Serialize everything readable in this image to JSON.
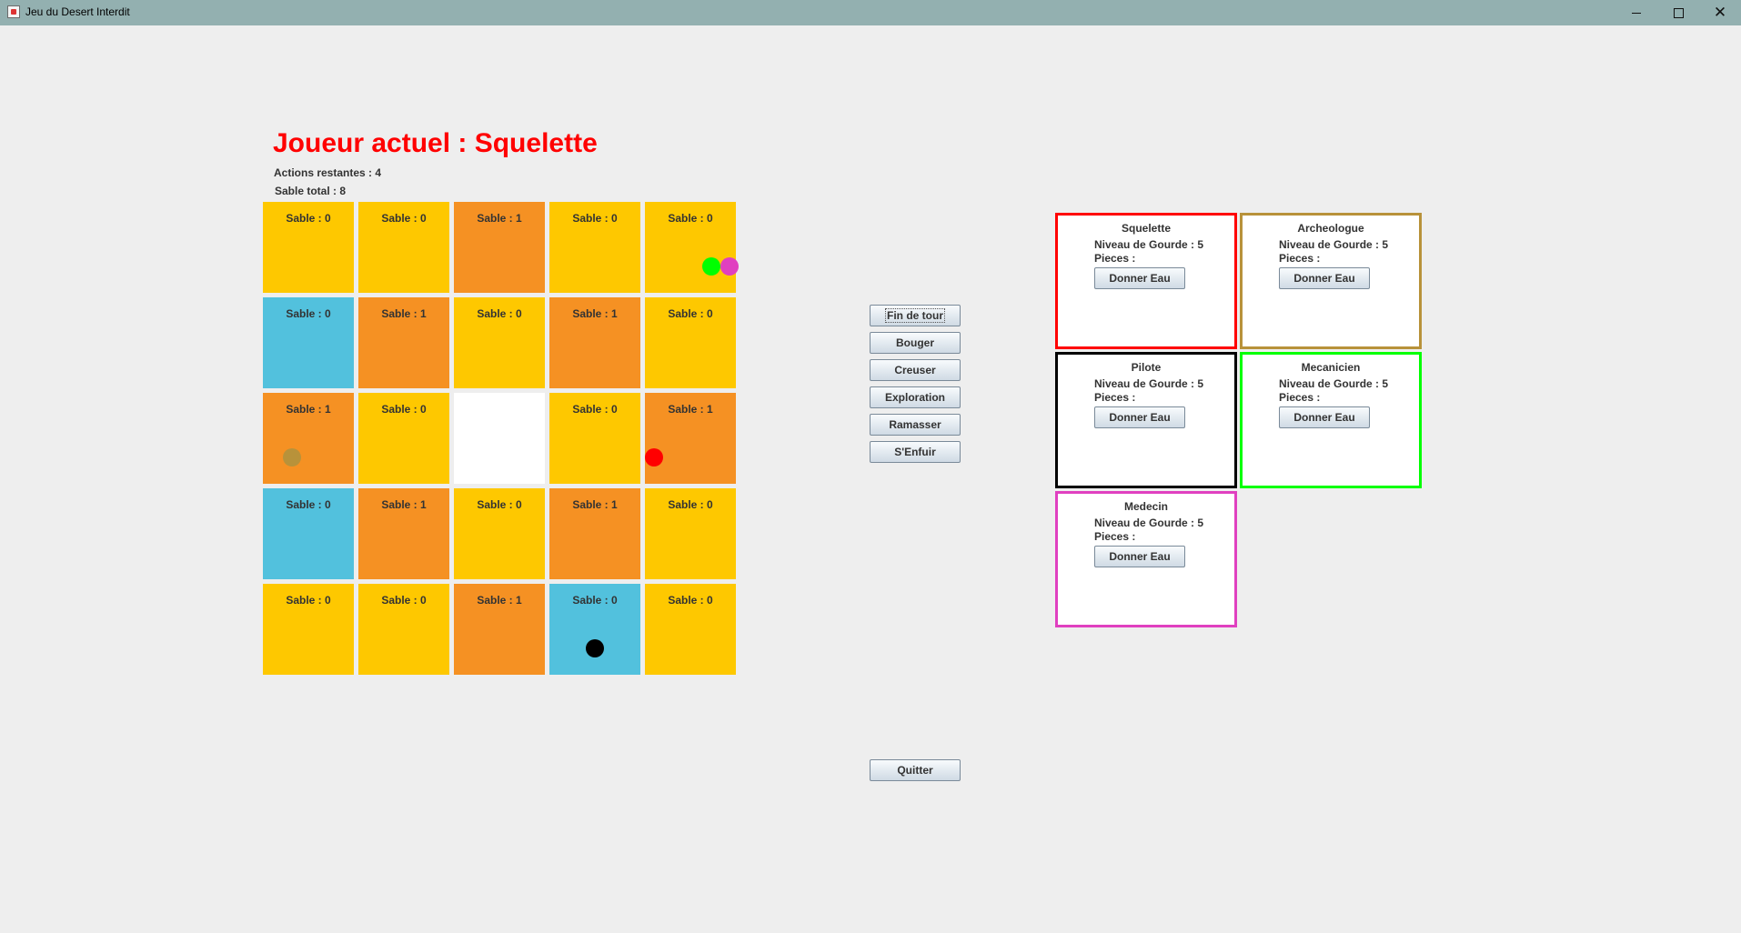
{
  "window": {
    "title": "Jeu du Desert Interdit",
    "minimize_icon": "minimize-icon",
    "maximize_icon": "maximize-icon",
    "close_icon": "close-icon"
  },
  "header": {
    "current_player": "Joueur actuel : Squelette",
    "actions_remaining": "Actions restantes : 4",
    "sand_total": "Sable total : 8"
  },
  "colors": {
    "desert": "#fec800",
    "sanded": "#f59123",
    "water": "#52c1dd",
    "empty": "#ffffff",
    "title_red": "#ff0000"
  },
  "grid": {
    "rows": [
      [
        {
          "label": "Sable : 0",
          "type": "desert"
        },
        {
          "label": "Sable : 0",
          "type": "desert"
        },
        {
          "label": "Sable : 1",
          "type": "sanded"
        },
        {
          "label": "Sable : 0",
          "type": "desert"
        },
        {
          "label": "Sable : 0",
          "type": "desert",
          "pawns": [
            "Mecanicien",
            "Medecin"
          ]
        }
      ],
      [
        {
          "label": "Sable : 0",
          "type": "water"
        },
        {
          "label": "Sable : 1",
          "type": "sanded"
        },
        {
          "label": "Sable : 0",
          "type": "desert"
        },
        {
          "label": "Sable : 1",
          "type": "sanded"
        },
        {
          "label": "Sable : 0",
          "type": "desert"
        }
      ],
      [
        {
          "label": "Sable : 1",
          "type": "sanded",
          "pawns": [
            "Archeologue"
          ]
        },
        {
          "label": "Sable : 0",
          "type": "desert"
        },
        {
          "label": "",
          "type": "empty"
        },
        {
          "label": "Sable : 0",
          "type": "desert"
        },
        {
          "label": "Sable : 1",
          "type": "sanded",
          "pawns": [
            "Squelette"
          ]
        }
      ],
      [
        {
          "label": "Sable : 0",
          "type": "water"
        },
        {
          "label": "Sable : 1",
          "type": "sanded"
        },
        {
          "label": "Sable : 0",
          "type": "desert"
        },
        {
          "label": "Sable : 1",
          "type": "sanded"
        },
        {
          "label": "Sable : 0",
          "type": "desert"
        }
      ],
      [
        {
          "label": "Sable : 0",
          "type": "desert"
        },
        {
          "label": "Sable : 0",
          "type": "desert"
        },
        {
          "label": "Sable : 1",
          "type": "sanded"
        },
        {
          "label": "Sable : 0",
          "type": "water",
          "pawns": [
            "Pilote"
          ]
        },
        {
          "label": "Sable : 0",
          "type": "desert"
        }
      ]
    ]
  },
  "actions": {
    "end_turn": "Fin de tour",
    "move": "Bouger",
    "dig": "Creuser",
    "explore": "Exploration",
    "pick_up": "Ramasser",
    "escape": "S'Enfuir",
    "quit": "Quitter"
  },
  "players": [
    {
      "name": "Squelette",
      "gourd": "Niveau de Gourde : 5",
      "pieces": "Pieces :",
      "button": "Donner Eau",
      "color": "#ff0000"
    },
    {
      "name": "Archeologue",
      "gourd": "Niveau de Gourde : 5",
      "pieces": "Pieces :",
      "button": "Donner Eau",
      "color": "#b8923a"
    },
    {
      "name": "Pilote",
      "gourd": "Niveau de Gourde : 5",
      "pieces": "Pieces :",
      "button": "Donner Eau",
      "color": "#000000"
    },
    {
      "name": "Mecanicien",
      "gourd": "Niveau de Gourde : 5",
      "pieces": "Pieces :",
      "button": "Donner Eau",
      "color": "#00ff00"
    },
    {
      "name": "Medecin",
      "gourd": "Niveau de Gourde : 5",
      "pieces": "Pieces :",
      "button": "Donner Eau",
      "color": "#e040c0"
    }
  ]
}
